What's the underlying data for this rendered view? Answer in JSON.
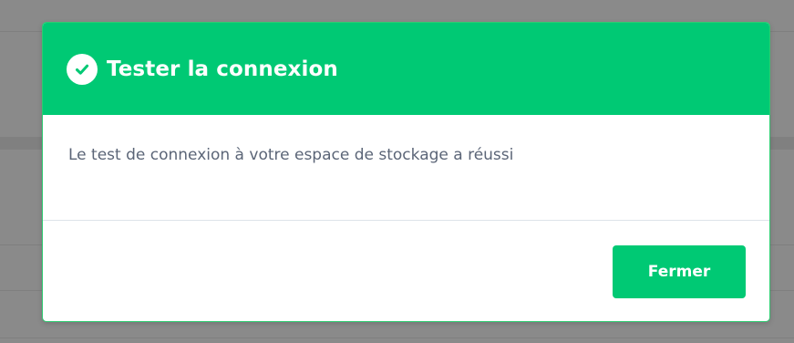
{
  "dialog": {
    "title": "Tester la connexion",
    "icon": "check-circle-icon",
    "message": "Le test de connexion à votre espace de stockage a réussi",
    "close_label": "Fermer"
  },
  "colors": {
    "accent": "#00c974",
    "overlay": "#8a8a8a",
    "message_text": "#5b6577"
  }
}
